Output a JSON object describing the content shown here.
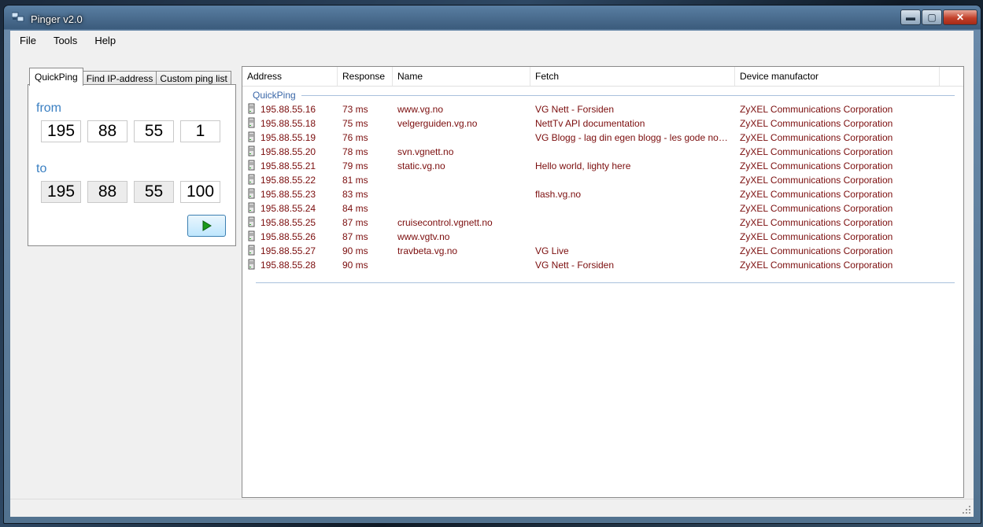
{
  "window": {
    "title": "Pinger v2.0"
  },
  "menu": [
    "File",
    "Tools",
    "Help"
  ],
  "tabs": [
    {
      "label": "QuickPing",
      "active": true
    },
    {
      "label": "Find IP-address",
      "active": false
    },
    {
      "label": "Custom ping list",
      "active": false
    }
  ],
  "quickping": {
    "from_label": "from",
    "to_label": "to",
    "from": [
      "195",
      "88",
      "55",
      "1"
    ],
    "to": [
      "195",
      "88",
      "55",
      "100"
    ]
  },
  "list": {
    "columns": [
      "Address",
      "Response",
      "Name",
      "Fetch",
      "Device manufactor"
    ],
    "group": "QuickPing",
    "rows": [
      [
        "195.88.55.16",
        "73 ms",
        "www.vg.no",
        "VG Nett - Forsiden",
        "ZyXEL Communications Corporation"
      ],
      [
        "195.88.55.18",
        "75 ms",
        "velgerguiden.vg.no",
        "NettTv API documentation",
        "ZyXEL Communications Corporation"
      ],
      [
        "195.88.55.19",
        "76 ms",
        "",
        "VG Blogg - lag din egen blogg - les gode norske bl...",
        "ZyXEL Communications Corporation"
      ],
      [
        "195.88.55.20",
        "78 ms",
        "svn.vgnett.no",
        "",
        "ZyXEL Communications Corporation"
      ],
      [
        "195.88.55.21",
        "79 ms",
        "static.vg.no",
        "Hello world, lighty here",
        "ZyXEL Communications Corporation"
      ],
      [
        "195.88.55.22",
        "81 ms",
        "",
        "",
        "ZyXEL Communications Corporation"
      ],
      [
        "195.88.55.23",
        "83 ms",
        "",
        "flash.vg.no",
        "ZyXEL Communications Corporation"
      ],
      [
        "195.88.55.24",
        "84 ms",
        "",
        "",
        "ZyXEL Communications Corporation"
      ],
      [
        "195.88.55.25",
        "87 ms",
        "cruisecontrol.vgnett.no",
        "",
        "ZyXEL Communications Corporation"
      ],
      [
        "195.88.55.26",
        "87 ms",
        "www.vgtv.no",
        "",
        "ZyXEL Communications Corporation"
      ],
      [
        "195.88.55.27",
        "90 ms",
        "travbeta.vg.no",
        "VG Live",
        "ZyXEL Communications Corporation"
      ],
      [
        "195.88.55.28",
        "90 ms",
        "",
        "VG Nett - Forsiden",
        "ZyXEL Communications Corporation"
      ]
    ]
  },
  "colors": {
    "row_text": "#7b0d0d",
    "label_blue": "#3a7fc2",
    "group_blue": "#3a67a8"
  },
  "icons": {
    "row": "server-icon",
    "go": "play-icon",
    "app": "network-computers-icon"
  }
}
